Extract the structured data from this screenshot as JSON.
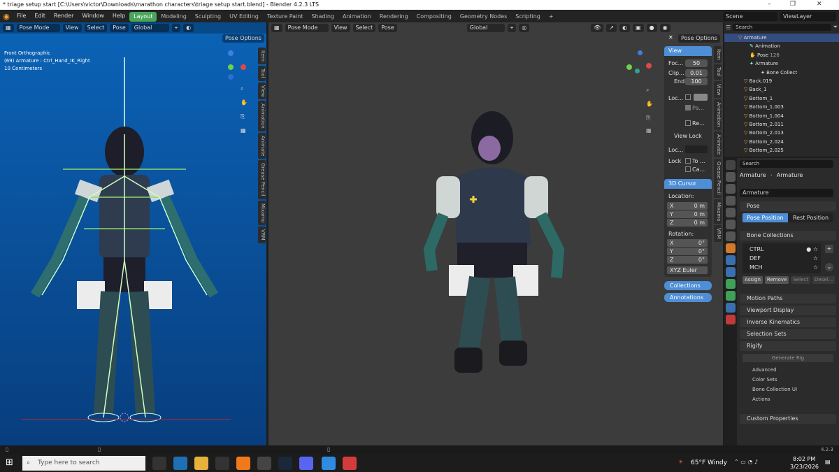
{
  "title": "* triage setup start [C:\\Users\\victor\\Downloads\\marathon characters\\triage setup start.blend] - Blender 4.2.3 LTS",
  "menu": [
    "File",
    "Edit",
    "Render",
    "Window",
    "Help"
  ],
  "workspaces": [
    "Layout",
    "Modeling",
    "Sculpting",
    "UV Editing",
    "Texture Paint",
    "Shading",
    "Animation",
    "Rendering",
    "Compositing",
    "Geometry Nodes",
    "Scripting"
  ],
  "active_workspace": "Layout",
  "scene": "Scene",
  "view_layer": "ViewLayer",
  "left_view": {
    "mode": "Pose Mode",
    "header_menus": [
      "View",
      "Select",
      "Pose"
    ],
    "orientation": "Global",
    "pose_options": "Pose Options",
    "overlay_lines": [
      "Front Orthographic",
      "(69) Armature : Ctrl_Hand_IK_Right",
      "10 Centimeters"
    ],
    "side_tabs": [
      "Item",
      "Tool",
      "View",
      "Animation",
      "Animate",
      "Grease Pencil",
      "Mixamo",
      "VRM"
    ]
  },
  "mid_view": {
    "mode": "Pose Mode",
    "header_menus": [
      "View",
      "Select",
      "Pose"
    ],
    "orientation": "Global",
    "pose_options": "Pose Options",
    "side_tabs": [
      "Item",
      "Tool",
      "View",
      "Animation",
      "Animate",
      "Grease Pencil",
      "Mixamo",
      "VRM"
    ],
    "npanel": {
      "view_header": "View",
      "focal_label": "Foc...",
      "focal": "50",
      "clip_label": "Clip...",
      "clip": "0.01",
      "end_label": "End",
      "end": "100",
      "loc_label": "Loc...",
      "pa_label": "Pa...",
      "re_label": "Re...",
      "view_lock": "View Lock",
      "lock_label": "Loc...",
      "lock2": "Lock",
      "to_label": "To ...",
      "ca_label": "Ca...",
      "cursor_header": "3D Cursor",
      "location_label": "Location:",
      "loc": [
        [
          "X",
          "0 m"
        ],
        [
          "Y",
          "0 m"
        ],
        [
          "Z",
          "0 m"
        ]
      ],
      "rotation_label": "Rotation:",
      "rot": [
        [
          "X",
          "0°"
        ],
        [
          "Y",
          "0°"
        ],
        [
          "Z",
          "0°"
        ]
      ],
      "euler": "XYZ Euler",
      "collections": "Collections",
      "annotations": "Annotations"
    }
  },
  "outliner": {
    "search_placeholder": "Search",
    "rows": [
      {
        "label": "Armature",
        "selected": true
      },
      {
        "label": "Animation"
      },
      {
        "label": "Pose"
      },
      {
        "label": "Armature"
      },
      {
        "label": "Bone Collect"
      },
      {
        "label": "Back.019"
      },
      {
        "label": "Back_1"
      },
      {
        "label": "Bottom_1"
      },
      {
        "label": "Bottom_1.003"
      },
      {
        "label": "Bottom_1.004"
      },
      {
        "label": "Bottom_2.011"
      },
      {
        "label": "Bottom_2.013"
      },
      {
        "label": "Bottom_2.024"
      },
      {
        "label": "Bottom_2.025"
      }
    ],
    "pose_count": "126"
  },
  "properties": {
    "search_placeholder": "Search",
    "breadcrumb": [
      "Armature",
      "Armature"
    ],
    "data_name": "Armature",
    "pose_section": "Pose",
    "pose_position": "Pose Position",
    "rest_position": "Rest Position",
    "bone_collections": "Bone Collections",
    "collections": [
      "CTRL",
      "DEF",
      "MCH"
    ],
    "assign": "Assign",
    "remove": "Remove",
    "select": "Select",
    "deselect": "Desel...",
    "sections": [
      "Motion Paths",
      "Viewport Display",
      "Inverse Kinematics",
      "Selection Sets"
    ],
    "rigify": "Rigify",
    "generate_rig": "Generate Rig",
    "rigify_subs": [
      "Advanced",
      "Color Sets",
      "Bone Collection UI",
      "Actions"
    ],
    "custom_properties": "Custom Properties"
  },
  "status_version": "4.2.3",
  "taskbar": {
    "search_placeholder": "Type here to search",
    "weather": "65°F  Windy",
    "time": "8:02 PM",
    "date": "3/23/2026"
  }
}
